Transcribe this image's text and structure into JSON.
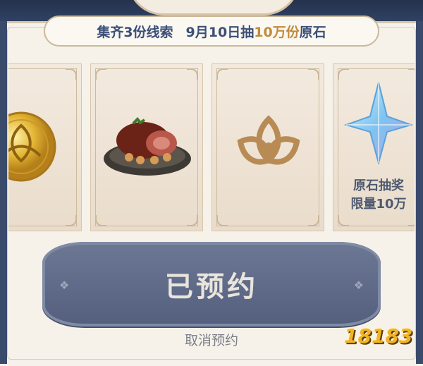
{
  "banner": {
    "part1": "集齐3份线索",
    "part2_prefix": "9月10日抽",
    "part2_highlight": "10万份",
    "part2_suffix": "原石"
  },
  "cards": [
    {
      "icon": "gold-coin-icon"
    },
    {
      "icon": "roast-meat-icon"
    },
    {
      "icon": "trinity-emblem-icon"
    },
    {
      "icon": "primogem-icon",
      "caption_line1": "原石抽奖",
      "caption_line2": "限量10万"
    }
  ],
  "reserve_button": {
    "label": "已预约"
  },
  "cancel_link": {
    "label": "取消预约"
  },
  "watermark": {
    "text": "18183"
  },
  "colors": {
    "accent": "#3c4f78",
    "highlight": "#c28a3a",
    "button": "#5f6b88"
  }
}
